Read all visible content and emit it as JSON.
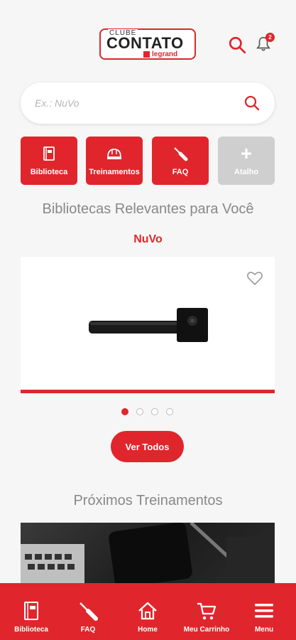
{
  "header": {
    "logo_top": "CLUBE",
    "logo_main": "CONTATO",
    "logo_brand": "legrand",
    "notification_count": "2"
  },
  "search": {
    "placeholder": "Ex.: NuVo"
  },
  "shortcuts": [
    {
      "label": "Biblioteca",
      "icon": "book-icon"
    },
    {
      "label": "Treinamentos",
      "icon": "helmet-icon"
    },
    {
      "label": "FAQ",
      "icon": "screwdriver-icon"
    },
    {
      "label": "Atalho",
      "icon": "plus-icon"
    }
  ],
  "libraries": {
    "title": "Bibliotecas Relevantes para Você",
    "current": "NuVo",
    "see_all": "Ver Todos",
    "carousel_pages": 4,
    "active_page": 1
  },
  "trainings": {
    "title": "Próximos Treinamentos"
  },
  "bottom_nav": [
    {
      "label": "Biblioteca",
      "icon": "book-icon"
    },
    {
      "label": "FAQ",
      "icon": "screwdriver-icon"
    },
    {
      "label": "Home",
      "icon": "home-icon"
    },
    {
      "label": "Meu Carrinho",
      "icon": "cart-icon"
    },
    {
      "label": "Menu",
      "icon": "menu-icon"
    }
  ],
  "colors": {
    "accent": "#e0262c",
    "disabled": "#cfcfcf",
    "background": "#f6f6f6"
  }
}
